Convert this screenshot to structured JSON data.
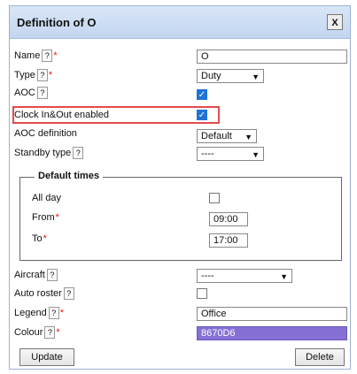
{
  "dialog": {
    "title": "Definition of O",
    "close_label": "X"
  },
  "form": {
    "name": {
      "label": "Name",
      "value": "O"
    },
    "type": {
      "label": "Type",
      "value": "Duty"
    },
    "aoc": {
      "label": "AOC",
      "checked": true
    },
    "clock_in_out": {
      "label": "Clock In&Out enabled",
      "checked": true
    },
    "aoc_definition": {
      "label": "AOC definition",
      "value": "Default"
    },
    "standby_type": {
      "label": "Standby type",
      "value": "----"
    },
    "aircraft": {
      "label": "Aircraft",
      "value": "----"
    },
    "auto_roster": {
      "label": "Auto roster",
      "checked": false
    },
    "legend": {
      "label": "Legend",
      "value": "Office"
    },
    "colour": {
      "label": "Colour",
      "value": "8670D6",
      "color": "#8670D6"
    }
  },
  "default_times": {
    "title": "Default times",
    "all_day": {
      "label": "All day",
      "checked": false
    },
    "from": {
      "label": "From",
      "value": "09:00"
    },
    "to": {
      "label": "To",
      "value": "17:00"
    }
  },
  "buttons": {
    "update": "Update",
    "delete": "Delete"
  },
  "help_glyph": "?",
  "required_glyph": "*",
  "dropdown_glyph": "▼",
  "check_glyph": "✓"
}
